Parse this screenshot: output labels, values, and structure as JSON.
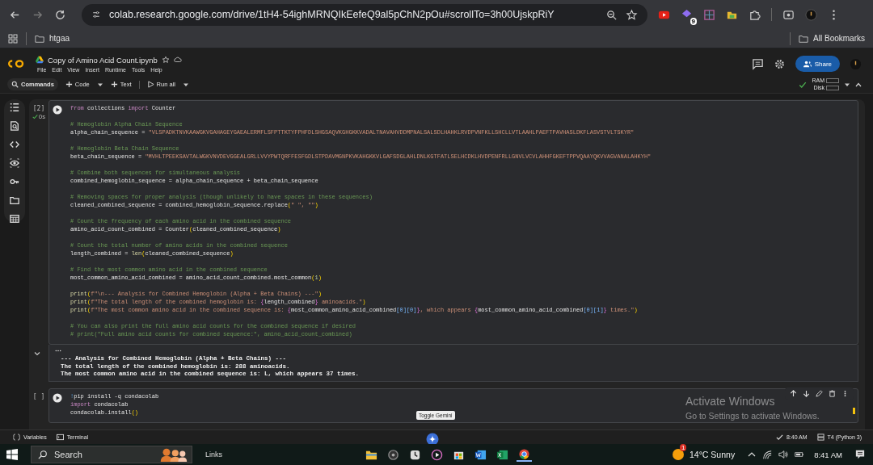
{
  "browser": {
    "url": "colab.research.google.com/drive/1tH4-54ighMRNQIkEefeQ9al5pChN2pOu#scrollTo=3h00UjskpRiY",
    "extension_badge": "9",
    "bookmarks": [
      {
        "label": "htgaa"
      }
    ],
    "all_bookmarks": "All Bookmarks"
  },
  "notebook": {
    "title": "Copy of Amino Acid Count.ipynb",
    "menu": [
      "File",
      "Edit",
      "View",
      "Insert",
      "Runtime",
      "Tools",
      "Help"
    ],
    "share": "Share",
    "toolbar": {
      "commands": "Commands",
      "code": "Code",
      "text": "Text",
      "run_all": "Run all"
    },
    "resources": {
      "ram": "RAM",
      "disk": "Disk"
    }
  },
  "cells": [
    {
      "exec_count": "[2]",
      "duration": "0s",
      "blocks": [
        [
          {
            "tokens": [
              {
                "kind": "kw",
                "text": "from"
              },
              {
                "kind": "txt",
                "text": " collections "
              },
              {
                "kind": "kw",
                "text": "import"
              },
              {
                "kind": "txt",
                "text": " Counter"
              }
            ]
          }
        ],
        [
          {
            "tokens": [
              {
                "kind": "com",
                "text": "# Hemoglobin Alpha Chain Sequence"
              }
            ]
          },
          {
            "tokens": [
              {
                "kind": "txt",
                "text": "alpha_chain_sequence = "
              },
              {
                "kind": "str",
                "text": "\"VLSPADKTNVKAAWGKVGAHAGEYGAEALERMFLSFPTTKTYFPHFDLSHGSAQVKGHGKKVADALTNAVAHVDDMPNALSALSDLHAHKLRVDPVNFKLLSHCLLVTLAAHLPAEFTPAVHASLDKFLASVSTVLTSKYR\""
              }
            ]
          }
        ],
        [
          {
            "tokens": [
              {
                "kind": "com",
                "text": "# Hemoglobin Beta Chain Sequence"
              }
            ]
          },
          {
            "tokens": [
              {
                "kind": "txt",
                "text": "beta_chain_sequence = "
              },
              {
                "kind": "str",
                "text": "\"MVHLTPEEKSAVTALWGKVNVDEVGGEALGRLLVVYPWTQRFFESFGDLSTPDAVMGNPKVKAHGKKVLGAFSDGLAHLDNLKGTFATLSELHCDKLHVDPENFRLLGNVLVCVLAHHFGKEFTPPVQAAYQKVVAGVANALAHKYH\""
              }
            ]
          }
        ],
        [
          {
            "tokens": [
              {
                "kind": "com",
                "text": "# Combine both sequences for simultaneous analysis"
              }
            ]
          },
          {
            "tokens": [
              {
                "kind": "txt",
                "text": "combined_hemoglobin_sequence = alpha_chain_sequence + beta_chain_sequence"
              }
            ]
          }
        ],
        [
          {
            "tokens": [
              {
                "kind": "com",
                "text": "# Removing spaces for proper analysis (though unlikely to have spaces in these sequences)"
              }
            ]
          },
          {
            "tokens": [
              {
                "kind": "txt",
                "text": "cleaned_combined_sequence = combined_hemoglobin_sequence.replace"
              },
              {
                "kind": "par",
                "text": "("
              },
              {
                "kind": "str",
                "text": "\" \", \"\""
              },
              {
                "kind": "par",
                "text": ")"
              }
            ]
          }
        ],
        [
          {
            "tokens": [
              {
                "kind": "com",
                "text": "# Count the frequency of each amino acid in the combined sequence"
              }
            ]
          },
          {
            "tokens": [
              {
                "kind": "txt",
                "text": "amino_acid_count_combined = Counter"
              },
              {
                "kind": "par",
                "text": "("
              },
              {
                "kind": "txt",
                "text": "cleaned_combined_sequence"
              },
              {
                "kind": "par",
                "text": ")"
              }
            ]
          }
        ],
        [
          {
            "tokens": [
              {
                "kind": "com",
                "text": "# Count the total number of amino acids in the combined sequence"
              }
            ]
          },
          {
            "tokens": [
              {
                "kind": "txt",
                "text": "length_combined = "
              },
              {
                "kind": "fn",
                "text": "len"
              },
              {
                "kind": "par",
                "text": "("
              },
              {
                "kind": "txt",
                "text": "cleaned_combined_sequence"
              },
              {
                "kind": "par",
                "text": ")"
              }
            ]
          }
        ],
        [
          {
            "tokens": [
              {
                "kind": "com",
                "text": "# Find the most common amino acid in the combined sequence"
              }
            ]
          },
          {
            "tokens": [
              {
                "kind": "txt",
                "text": "most_common_amino_acid_combined = amino_acid_count_combined.most_common"
              },
              {
                "kind": "par",
                "text": "("
              },
              {
                "kind": "num",
                "text": "1"
              },
              {
                "kind": "par",
                "text": ")"
              }
            ]
          }
        ],
        [
          {
            "tokens": [
              {
                "kind": "fn",
                "text": "print"
              },
              {
                "kind": "par",
                "text": "("
              },
              {
                "kind": "str",
                "text": "f\"\\n--- Analysis for Combined Hemoglobin (Alpha + Beta Chains) ---\""
              },
              {
                "kind": "par",
                "text": ")"
              }
            ]
          },
          {
            "tokens": [
              {
                "kind": "fn",
                "text": "print"
              },
              {
                "kind": "par",
                "text": "("
              },
              {
                "kind": "str",
                "text": "f\"The total length of the combined hemoglobin is: "
              },
              {
                "kind": "brc",
                "text": "{"
              },
              {
                "kind": "txt",
                "text": "length_combined"
              },
              {
                "kind": "brc",
                "text": "}"
              },
              {
                "kind": "str",
                "text": " aminoacids.\""
              },
              {
                "kind": "par",
                "text": ")"
              }
            ]
          },
          {
            "tokens": [
              {
                "kind": "fn",
                "text": "print"
              },
              {
                "kind": "par",
                "text": "("
              },
              {
                "kind": "str",
                "text": "f\"The most common amino acid in the combined sequence is: "
              },
              {
                "kind": "brc",
                "text": "{"
              },
              {
                "kind": "txt",
                "text": "most_common_amino_acid_combined"
              },
              {
                "kind": "sq",
                "text": "[0][0]"
              },
              {
                "kind": "brc",
                "text": "}"
              },
              {
                "kind": "str",
                "text": ", which appears "
              },
              {
                "kind": "brc",
                "text": "{"
              },
              {
                "kind": "txt",
                "text": "most_common_amino_acid_combined"
              },
              {
                "kind": "sq",
                "text": "[0][1]"
              },
              {
                "kind": "brc",
                "text": "}"
              },
              {
                "kind": "str",
                "text": " times.\""
              },
              {
                "kind": "par",
                "text": ")"
              }
            ]
          }
        ],
        [
          {
            "tokens": [
              {
                "kind": "com",
                "text": "# You can also print the full amino acid counts for the combined sequence if desired"
              }
            ]
          },
          {
            "tokens": [
              {
                "kind": "com",
                "text": "# print(\"Full amino acid counts for combined sequence:\", amino_acid_count_combined)"
              }
            ]
          }
        ]
      ],
      "output": [
        "--- Analysis for Combined Hemoglobin (Alpha + Beta Chains) ---",
        "The total length of the combined hemoglobin is: 288 aminoacids.",
        "The most common amino acid in the combined sequence is: L, which appears 37 times."
      ]
    },
    {
      "exec_count": "[ ]",
      "blocks": [
        [
          {
            "tokens": [
              {
                "kind": "bang",
                "text": "!"
              },
              {
                "kind": "txt",
                "text": "pip install -q condacolab"
              }
            ]
          },
          {
            "tokens": [
              {
                "kind": "kw",
                "text": "import"
              },
              {
                "kind": "txt",
                "text": " condacolab"
              }
            ]
          },
          {
            "tokens": [
              {
                "kind": "txt",
                "text": "condacolab.install"
              },
              {
                "kind": "par",
                "text": "()"
              }
            ]
          }
        ]
      ]
    }
  ],
  "tooltip": "Toggle Gemini",
  "activation": {
    "title": "Activate Windows",
    "text": "Go to Settings to activate Windows."
  },
  "status_bar": {
    "variables": "Variables",
    "terminal": "Terminal",
    "saved_time": "8:40 AM",
    "runtime": "T4 (Python 3)"
  },
  "taskbar": {
    "search": "Search",
    "links": "Links",
    "weather_badge": "1",
    "weather": "14°C Sunny",
    "time": "8:41 AM"
  }
}
